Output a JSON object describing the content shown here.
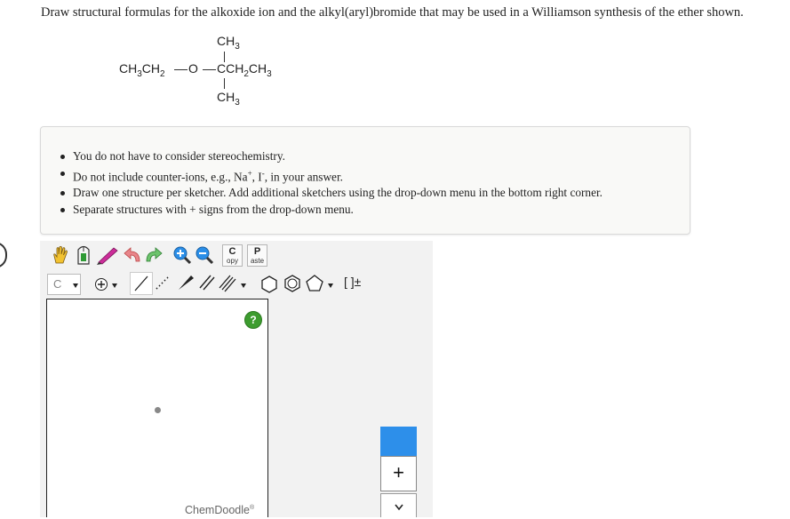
{
  "question": "Draw structural formulas for the alkoxide ion and the alkyl(aryl)bromide that may be used in a Williamson synthesis of the ether shown.",
  "molecule": {
    "top_group": "CH3",
    "left_chain": "CH3CH2",
    "oxygen": "O",
    "center_chain": "CCH2CH3",
    "bottom_group": "CH3"
  },
  "notes": [
    "You do not have to consider stereochemistry.",
    "Do not include counter-ions, e.g., Na+, I-, in your answer.",
    "Draw one structure per sketcher. Add additional sketchers using the drop-down menu in the bottom right corner.",
    "Separate structures with + signs from the drop-down menu."
  ],
  "toolbar": {
    "copy_letter": "C",
    "copy_label": "opy",
    "paste_letter": "P",
    "paste_label": "aste",
    "element_value": "C",
    "bracket_label": "[ ]±"
  },
  "canvas": {
    "help_label": "?",
    "brand": "ChemDoodle",
    "brand_mark": "®"
  },
  "side_controls": {
    "add_label": "+",
    "dropdown_label": "⌄"
  },
  "colors": {
    "accent_blue": "#2d8fea",
    "help_green": "#3d9c2f",
    "notes_bg": "#f9f9f7"
  }
}
